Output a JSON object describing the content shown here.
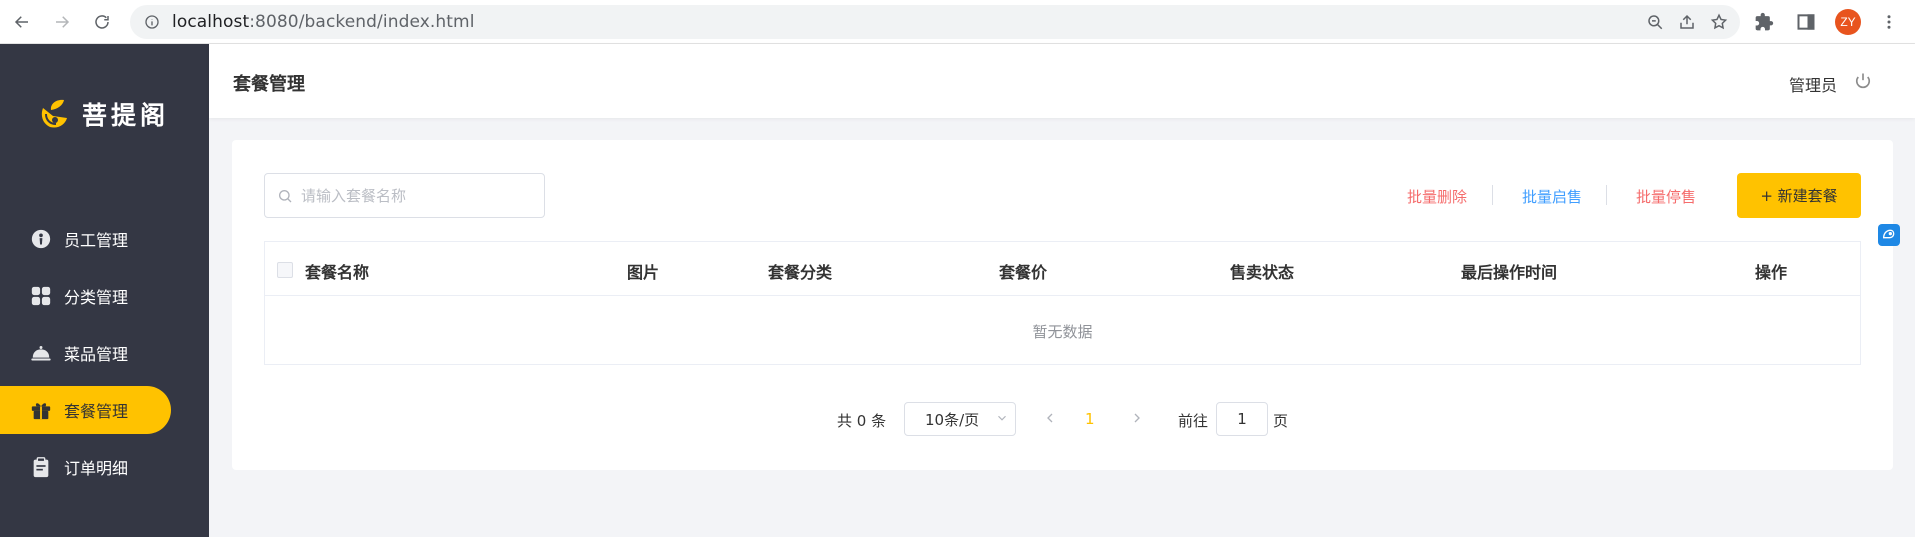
{
  "browser": {
    "url_host": "localhost",
    "url_path": ":8080/backend/index.html",
    "avatar_initials": "ZY"
  },
  "sidebar": {
    "logo_text": "菩提阁",
    "items": [
      {
        "label": "员工管理",
        "icon": "employee-icon",
        "active": false
      },
      {
        "label": "分类管理",
        "icon": "category-grid-icon",
        "active": false
      },
      {
        "label": "菜品管理",
        "icon": "dish-cloche-icon",
        "active": false
      },
      {
        "label": "套餐管理",
        "icon": "gift-package-icon",
        "active": true
      },
      {
        "label": "订单明细",
        "icon": "clipboard-order-icon",
        "active": false
      }
    ]
  },
  "header": {
    "title": "套餐管理",
    "user": "管理员"
  },
  "toolbar": {
    "search_placeholder": "请输入套餐名称",
    "batch_delete": "批量删除",
    "batch_enable": "批量启售",
    "batch_disable": "批量停售",
    "new_button": "+ 新建套餐"
  },
  "table": {
    "columns": [
      "套餐名称",
      "图片",
      "套餐分类",
      "套餐价",
      "售卖状态",
      "最后操作时间",
      "操作"
    ],
    "rows": [],
    "empty_text": "暂无数据"
  },
  "pagination": {
    "total_label": "共 0 条",
    "page_size": "10条/页",
    "current_page": "1",
    "goto_label": "前往",
    "goto_value": "1",
    "page_suffix": "页"
  },
  "colors": {
    "accent": "#ffc200",
    "sidebar_bg": "#343744",
    "danger_link": "#f56c6c",
    "primary_link": "#409eff"
  }
}
